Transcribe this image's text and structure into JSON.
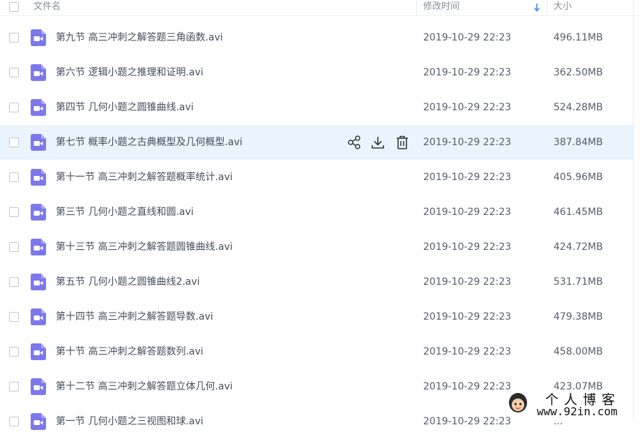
{
  "header": {
    "name_label": "文件名",
    "date_label": "修改时间",
    "size_label": "大小",
    "sort_icon": "arrow-down-icon",
    "sort_color": "#3b8cf0"
  },
  "colors": {
    "file_icon": "#7b78ec",
    "hover_row": "#e9f4fd",
    "action_icon": "#333333"
  },
  "files": [
    {
      "name": "第九节 高三冲刺之解答题三角函数.avi",
      "date": "2019-10-29 22:23",
      "size": "496.11MB",
      "icon": "video-file-icon"
    },
    {
      "name": "第六节 逻辑小题之推理和证明.avi",
      "date": "2019-10-29 22:23",
      "size": "362.50MB",
      "icon": "video-file-icon"
    },
    {
      "name": "第四节 几何小题之圆锥曲线.avi",
      "date": "2019-10-29 22:23",
      "size": "524.28MB",
      "icon": "video-file-icon"
    },
    {
      "name": "第七节 概率小题之古典概型及几何概型.avi",
      "date": "2019-10-29 22:23",
      "size": "387.84MB",
      "icon": "video-file-icon",
      "hovered": true
    },
    {
      "name": "第十一节 高三冲刺之解答题概率统计.avi",
      "date": "2019-10-29 22:23",
      "size": "405.96MB",
      "icon": "video-file-icon"
    },
    {
      "name": "第三节 几何小题之直线和圆.avi",
      "date": "2019-10-29 22:23",
      "size": "461.45MB",
      "icon": "video-file-icon"
    },
    {
      "name": "第十三节 高三冲刺之解答题圆锥曲线.avi",
      "date": "2019-10-29 22:23",
      "size": "424.72MB",
      "icon": "video-file-icon"
    },
    {
      "name": "第五节 几何小题之圆锥曲线2.avi",
      "date": "2019-10-29 22:23",
      "size": "531.71MB",
      "icon": "video-file-icon"
    },
    {
      "name": "第十四节 高三冲刺之解答题导数.avi",
      "date": "2019-10-29 22:23",
      "size": "479.38MB",
      "icon": "video-file-icon"
    },
    {
      "name": "第十节 高三冲刺之解答题数列.avi",
      "date": "2019-10-29 22:23",
      "size": "458.00MB",
      "icon": "video-file-icon"
    },
    {
      "name": "第十二节 高三冲刺之解答题立体几何.avi",
      "date": "2019-10-29 22:23",
      "size": "423.07MB",
      "icon": "video-file-icon"
    },
    {
      "name": "第一节 几何小题之三视图和球.avi",
      "date": "2019-10-29 22:23",
      "size": "...",
      "icon": "video-file-icon"
    }
  ],
  "row_actions": [
    {
      "icon": "share-icon"
    },
    {
      "icon": "download-icon"
    },
    {
      "icon": "delete-icon"
    }
  ],
  "watermark": {
    "title": "个人博客",
    "url": "www.92in.com"
  }
}
